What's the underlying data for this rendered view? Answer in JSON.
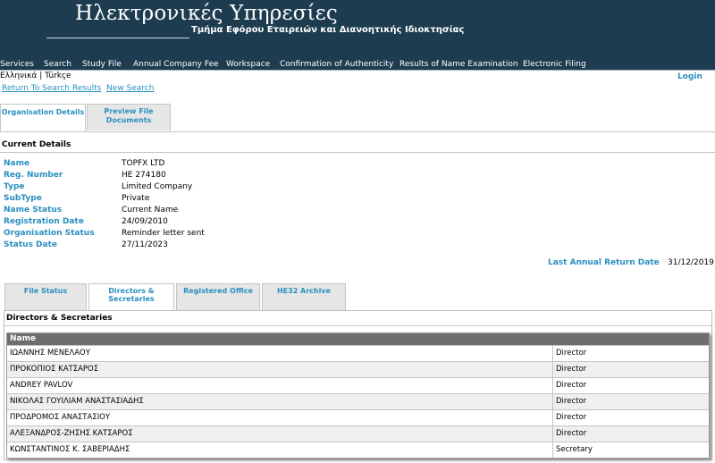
{
  "header": {
    "title": "Ηλεκτρονικές Υπηρεσίες",
    "subtitle": "Τμήμα Εφόρου Εταιρειών και Διανοητικής Ιδιοκτησίας"
  },
  "nav": {
    "items": [
      "Services",
      "Search",
      "Study File",
      "Annual Company Fee",
      "Workspace",
      "Confirmation of Authenticity",
      "Results of Name Examination",
      "Electronic Filing"
    ]
  },
  "language": {
    "greek": "Ελληνικά",
    "separator": " | ",
    "turkish": "Türkçe"
  },
  "login_label": "Login",
  "links": {
    "return_to_search": "Return To Search Results",
    "new_search": "New Search"
  },
  "top_tabs": {
    "organisation_details": "Organisation Details",
    "preview_line1": "Preview File",
    "preview_line2": "Documents"
  },
  "current_details": {
    "title": "Current Details",
    "fields": [
      {
        "label": "Name",
        "value": "TOPFX LTD"
      },
      {
        "label": "Reg. Number",
        "value": "HE 274180"
      },
      {
        "label": "Type",
        "value": "Limited Company"
      },
      {
        "label": "SubType",
        "value": "Private"
      },
      {
        "label": "Name Status",
        "value": "Current Name"
      },
      {
        "label": "Registration Date",
        "value": "24/09/2010"
      },
      {
        "label": "Organisation Status",
        "value": "Reminder letter sent"
      },
      {
        "label": "Status Date",
        "value": "27/11/2023"
      }
    ],
    "last_annual_return_label": "Last Annual Return Date",
    "last_annual_return_value": "31/12/2019"
  },
  "lower_tabs": {
    "file_status": "File Status",
    "directors": "Directors & Secretaries",
    "registered_office": "Registered Office",
    "he32": "HE32 Archive"
  },
  "directors": {
    "title": "Directors & Secretaries",
    "column_name": "Name",
    "rows": [
      {
        "name": "ΙΩΑΝΝΗΣ ΜΕΝΕΛΑΟΥ",
        "role": "Director"
      },
      {
        "name": "ΠΡΟΚΟΠΙΟΣ ΚΑΤΣΑΡΟΣ",
        "role": "Director"
      },
      {
        "name": "ANDREY PAVLOV",
        "role": "Director"
      },
      {
        "name": "ΝΙΚΟΛΑΣ ΓΟΥΙΛΙΑΜ ΑΝΑΣΤΑΣΙΑΔΗΣ",
        "role": "Director"
      },
      {
        "name": "ΠΡΟΔΡΟΜΟΣ ΑΝΑΣΤΑΣΙΟΥ",
        "role": "Director"
      },
      {
        "name": "ΑΛΕΞΑΝΔΡΟΣ-ΖΗΣΗΣ ΚΑΤΣΑΡΟΣ",
        "role": "Director"
      },
      {
        "name": "ΚΩΝΣΤΑΝΤΙΝΟΣ Κ. ΣΑΒΕΡΙΑΔΗΣ",
        "role": "Secretary"
      }
    ]
  }
}
